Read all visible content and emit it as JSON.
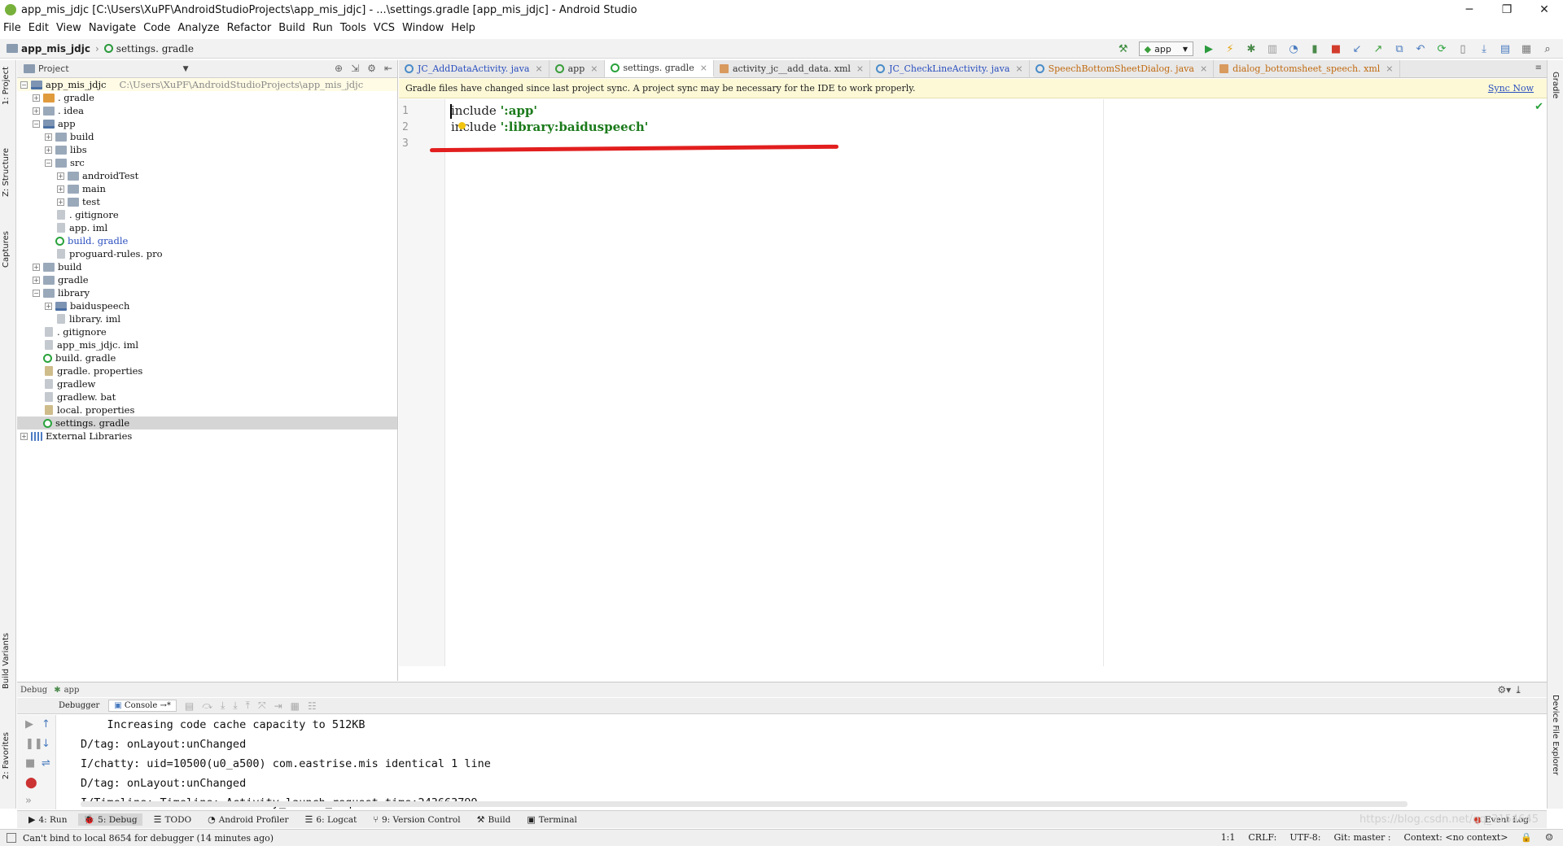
{
  "window": {
    "title": "app_mis_jdjc [C:\\Users\\XuPF\\AndroidStudioProjects\\app_mis_jdjc] - ...\\settings.gradle [app_mis_jdjc] - Android Studio",
    "minimize": "─",
    "restore": "❐",
    "close": "✕"
  },
  "menu": [
    "File",
    "Edit",
    "View",
    "Navigate",
    "Code",
    "Analyze",
    "Refactor",
    "Build",
    "Run",
    "Tools",
    "VCS",
    "Window",
    "Help"
  ],
  "breadcrumb": {
    "project": "app_mis_jdjc",
    "file": "settings. gradle"
  },
  "run_config": "app",
  "toolbar_icons": [
    "hammer-icon",
    "run-icon",
    "apply-changes-icon",
    "debug-icon",
    "profile-icon",
    "attach-icon",
    "stop-icon",
    "vcs-update-icon",
    "vcs-commit-icon",
    "vcs-compare-icon",
    "vcs-revert-icon",
    "sync-icon",
    "avd-manager-icon",
    "sdk-manager-icon",
    "structure-icon",
    "search-icon"
  ],
  "left_strip": {
    "project": "1: Project",
    "structure": "Z: Structure",
    "captures": "Captures",
    "build_variants": "Build Variants",
    "favorites": "2: Favorites"
  },
  "right_strip": {
    "gradle": "Gradle",
    "device_explorer": "Device File Explorer"
  },
  "project_panel": {
    "view_mode": "Project",
    "tree": [
      {
        "label": "app_mis_jdjc",
        "path": "C:\\Users\\XuPF\\AndroidStudioProjects\\app_mis_jdjc",
        "depth": 0,
        "exp": "−",
        "icon": "folder-mod"
      },
      {
        "label": ". gradle",
        "depth": 1,
        "exp": "+",
        "icon": "folder-orange"
      },
      {
        "label": ". idea",
        "depth": 1,
        "exp": "+",
        "icon": "folder"
      },
      {
        "label": "app",
        "depth": 1,
        "exp": "−",
        "icon": "folder-mod"
      },
      {
        "label": "build",
        "depth": 2,
        "exp": "+",
        "icon": "folder"
      },
      {
        "label": "libs",
        "depth": 2,
        "exp": "+",
        "icon": "folder"
      },
      {
        "label": "src",
        "depth": 2,
        "exp": "−",
        "icon": "folder"
      },
      {
        "label": "androidTest",
        "depth": 3,
        "exp": "+",
        "icon": "folder"
      },
      {
        "label": "main",
        "depth": 3,
        "exp": "+",
        "icon": "folder"
      },
      {
        "label": "test",
        "depth": 3,
        "exp": "+",
        "icon": "folder"
      },
      {
        "label": ". gitignore",
        "depth": 2,
        "exp": "",
        "icon": "file"
      },
      {
        "label": "app. iml",
        "depth": 2,
        "exp": "",
        "icon": "file"
      },
      {
        "label": "build. gradle",
        "depth": 2,
        "exp": "",
        "icon": "gradle",
        "blue": true
      },
      {
        "label": "proguard-rules. pro",
        "depth": 2,
        "exp": "",
        "icon": "file"
      },
      {
        "label": "build",
        "depth": 1,
        "exp": "+",
        "icon": "folder"
      },
      {
        "label": "gradle",
        "depth": 1,
        "exp": "+",
        "icon": "folder"
      },
      {
        "label": "library",
        "depth": 1,
        "exp": "−",
        "icon": "folder"
      },
      {
        "label": "baiduspeech",
        "depth": 2,
        "exp": "+",
        "icon": "folder-mod"
      },
      {
        "label": "library. iml",
        "depth": 2,
        "exp": "",
        "icon": "file"
      },
      {
        "label": ". gitignore",
        "depth": 1,
        "exp": "",
        "icon": "file"
      },
      {
        "label": "app_mis_jdjc. iml",
        "depth": 1,
        "exp": "",
        "icon": "file"
      },
      {
        "label": "build. gradle",
        "depth": 1,
        "exp": "",
        "icon": "gradle"
      },
      {
        "label": "gradle. properties",
        "depth": 1,
        "exp": "",
        "icon": "prop"
      },
      {
        "label": "gradlew",
        "depth": 1,
        "exp": "",
        "icon": "file"
      },
      {
        "label": "gradlew. bat",
        "depth": 1,
        "exp": "",
        "icon": "file"
      },
      {
        "label": "local. properties",
        "depth": 1,
        "exp": "",
        "icon": "prop"
      },
      {
        "label": "settings. gradle",
        "depth": 1,
        "exp": "",
        "icon": "gradle",
        "selected": true
      },
      {
        "label": "External Libraries",
        "depth": 0,
        "exp": "+",
        "icon": "lib"
      }
    ]
  },
  "tabs": [
    {
      "label": "JC_AddDataActivity. java",
      "icon": "c",
      "style": "blue-text"
    },
    {
      "label": "app",
      "icon": "a",
      "style": ""
    },
    {
      "label": "settings. gradle",
      "icon": "g",
      "style": "",
      "active": true
    },
    {
      "label": "activity_jc__add_data. xml",
      "icon": "x",
      "style": ""
    },
    {
      "label": "JC_CheckLineActivity. java",
      "icon": "c",
      "style": "blue-text"
    },
    {
      "label": "SpeechBottomSheetDialog. java",
      "icon": "c",
      "style": "orange-text"
    },
    {
      "label": "dialog_bottomsheet_speech. xml",
      "icon": "x",
      "style": "orange-text"
    }
  ],
  "banner": {
    "message": "Gradle files have changed since last project sync. A project sync may be necessary for the IDE to work properly.",
    "action": "Sync Now"
  },
  "editor": {
    "lines": [
      {
        "num": "1",
        "keyword": "include",
        "value": "':app'"
      },
      {
        "num": "2",
        "keyword": "include",
        "value": "':library:baiduspeech'"
      },
      {
        "num": "3",
        "keyword": "",
        "value": ""
      }
    ]
  },
  "debug_panel": {
    "header": "Debug",
    "config": "app",
    "tabs": {
      "debugger": "Debugger",
      "console": "Console"
    },
    "console_lines": [
      "    Increasing code cache capacity to 512KB",
      "D/tag: onLayout:unChanged",
      "I/chatty: uid=10500(u0_a500) com.eastrise.mis identical 1 line",
      "D/tag: onLayout:unChanged",
      "I/Timeline: Timeline: Activity_launch_request time:243663799"
    ]
  },
  "bottom_tools": [
    {
      "label": "4: Run",
      "icon": "▶"
    },
    {
      "label": "5: Debug",
      "icon": "🐞",
      "active": true
    },
    {
      "label": "TODO",
      "icon": "☰"
    },
    {
      "label": "Android Profiler",
      "icon": "◔"
    },
    {
      "label": "6: Logcat",
      "icon": "☰"
    },
    {
      "label": "9: Version Control",
      "icon": "⑂"
    },
    {
      "label": "Build",
      "icon": "⚒"
    },
    {
      "label": "Terminal",
      "icon": "▣"
    }
  ],
  "event_log": "Event Log",
  "watermark": "https://blog.csdn.net/qq_3154645",
  "status": {
    "message": "Can't bind to local 8654 for debugger (14 minutes ago)",
    "position": "1:1",
    "line_sep": "CRLF:",
    "encoding": "UTF-8:",
    "git": "Git: master :",
    "context": "Context: <no context>"
  }
}
